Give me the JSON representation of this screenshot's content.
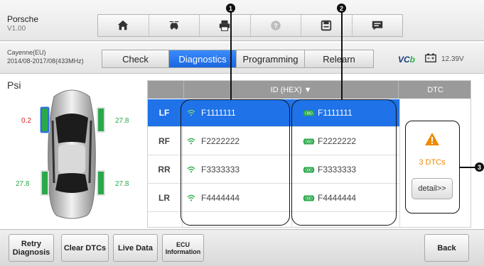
{
  "header": {
    "title": "Porsche",
    "version": "V1.00"
  },
  "toolbar": {
    "icons": [
      "home-icon",
      "car-swap-icon",
      "print-icon",
      "help-icon",
      "save-icon",
      "message-icon"
    ]
  },
  "vehicle": {
    "model": "Cayenne(EU)",
    "info": "2014/08-2017/08(433MHz)"
  },
  "tabs": [
    {
      "label": "Check",
      "active": false
    },
    {
      "label": "Diagnostics",
      "active": true
    },
    {
      "label": "Programming",
      "active": false
    },
    {
      "label": "Relearn",
      "active": false
    }
  ],
  "status": {
    "vci_prefix": "VC",
    "vci_suffix": "b",
    "voltage": "12.39V"
  },
  "pressure": {
    "unit": "Psi",
    "tires": [
      {
        "position": "front-left",
        "value": "0.2",
        "alert": true
      },
      {
        "position": "front-right",
        "value": "27.8",
        "alert": false
      },
      {
        "position": "rear-left",
        "value": "27.8",
        "alert": false
      },
      {
        "position": "rear-right",
        "value": "27.8",
        "alert": false
      }
    ]
  },
  "table": {
    "id_header": "ID (HEX) ▼",
    "dtc_header": "DTC",
    "rows": [
      {
        "position": "LF",
        "sensor_id": "F1111111",
        "ecu_id": "F1111111",
        "selected": true
      },
      {
        "position": "RF",
        "sensor_id": "F2222222",
        "ecu_id": "F2222222",
        "selected": false
      },
      {
        "position": "RR",
        "sensor_id": "F3333333",
        "ecu_id": "F3333333",
        "selected": false
      },
      {
        "position": "LR",
        "sensor_id": "F4444444",
        "ecu_id": "F4444444",
        "selected": false
      }
    ]
  },
  "dtc": {
    "count_text": "3 DTCs",
    "detail_label": "detail>>",
    "warning_color": "#f08a00"
  },
  "callouts": [
    "1",
    "2",
    "3"
  ],
  "bottom_buttons": [
    {
      "line1": "Retry",
      "line2": "Diagnosis"
    },
    {
      "line1": "Clear DTCs",
      "line2": ""
    },
    {
      "line1": "Live Data",
      "line2": ""
    },
    {
      "line1": "ECU",
      "line2": "Information"
    },
    {
      "line1": "Back",
      "line2": ""
    }
  ],
  "colors": {
    "accent": "#1f72e8",
    "tire_ok": "#2aa84a",
    "tire_alert": "#e02020",
    "header_gray": "#9a9a9a"
  }
}
